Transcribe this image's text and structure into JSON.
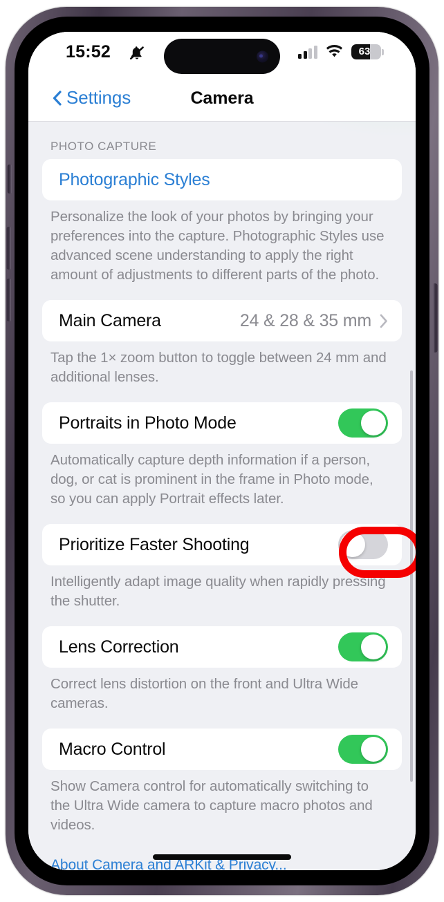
{
  "status_bar": {
    "time": "15:52",
    "mute_icon": "bell-slash-icon",
    "signal_icon": "cellular-signal-icon",
    "wifi_icon": "wifi-icon",
    "battery_level": "63",
    "battery_percent": 63
  },
  "nav": {
    "back_label": "Settings",
    "back_icon": "chevron-left-icon",
    "title": "Camera"
  },
  "content": {
    "section_header": "PHOTO CAPTURE",
    "photographic_styles": {
      "label": "Photographic Styles",
      "footnote": "Personalize the look of your photos by bringing your preferences into the capture. Photographic Styles use advanced scene understanding to apply the right amount of adjustments to different parts of the photo."
    },
    "main_camera": {
      "label": "Main Camera",
      "value": "24 & 28 & 35 mm",
      "chevron_icon": "chevron-right-icon",
      "footnote": "Tap the 1× zoom button to toggle between 24 mm and additional lenses."
    },
    "portraits_in_photo_mode": {
      "label": "Portraits in Photo Mode",
      "toggle_state": "on",
      "footnote": "Automatically capture depth information if a person, dog, or cat is prominent in the frame in Photo mode, so you can apply Portrait effects later."
    },
    "prioritize_faster_shooting": {
      "label": "Prioritize Faster Shooting",
      "toggle_state": "off",
      "highlighted": true,
      "footnote": "Intelligently adapt image quality when rapidly pressing the shutter."
    },
    "lens_correction": {
      "label": "Lens Correction",
      "toggle_state": "on",
      "footnote": "Correct lens distortion on the front and Ultra Wide cameras."
    },
    "macro_control": {
      "label": "Macro Control",
      "toggle_state": "on",
      "footnote": "Show Camera control for automatically switching to the Ultra Wide camera to capture macro photos and videos."
    },
    "footer_link": "About Camera and ARKit & Privacy..."
  },
  "colors": {
    "accent_blue": "#2b7fd4",
    "toggle_on_green": "#32c759",
    "toggle_off_gray": "#d5d5da",
    "annotation_red": "#f50000",
    "page_background": "#eff0f4",
    "card_background": "#ffffff",
    "secondary_text": "#8a8a90"
  }
}
